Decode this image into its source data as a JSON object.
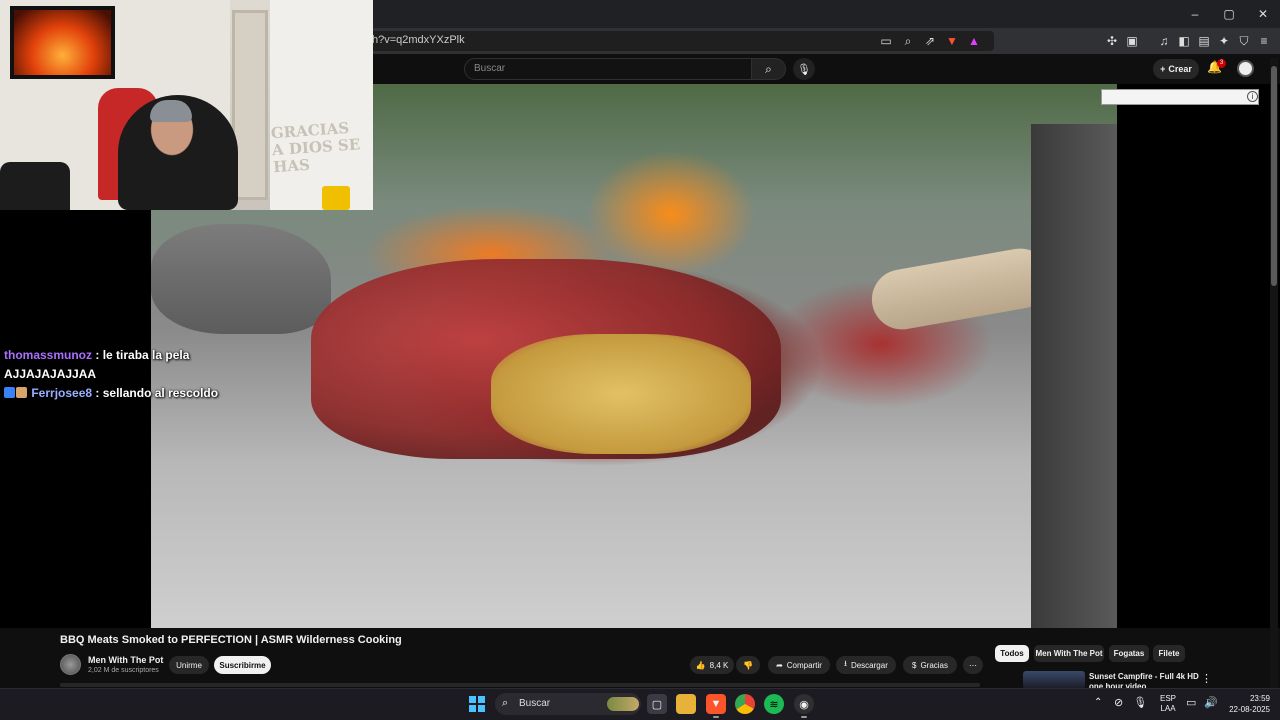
{
  "browser": {
    "url": "h?v=q2mdxYXzPlk",
    "window_controls": [
      "–",
      "▢",
      "✕"
    ],
    "url_icons": [
      "cast-icon",
      "zoom-icon",
      "share-icon",
      "brave-shield-icon",
      "rewards-icon"
    ],
    "extension_icons": [
      "puzzle-icon",
      "save-icon",
      "music-icon",
      "sidebar-icon",
      "wallet-icon",
      "leo-icon",
      "vpn-icon",
      "menu-icon"
    ]
  },
  "youtube_header": {
    "search_placeholder": "Buscar",
    "create_label": "Crear",
    "notification_count": "3"
  },
  "webcam": {
    "wall_text": "GRACIAS A DIOS SE HAS"
  },
  "chat": [
    {
      "user": "thomassmunoz",
      "message": "le tiraba la pela AJJAJAJAJJAA"
    },
    {
      "user": "Ferrjosee8",
      "message": "sellando al rescoldo"
    }
  ],
  "video": {
    "title": "BBQ Meats Smoked to PERFECTION | ASMR Wilderness Cooking",
    "channel": "Men With The Pot",
    "subscribers": "2,02 M de suscriptores",
    "join_label": "Unirme",
    "subscribe_label": "Suscribirme",
    "likes": "8,4 K",
    "share_label": "Compartir",
    "download_label": "Descargar",
    "thanks_label": "Gracias",
    "more_label": "⋯"
  },
  "chips": [
    "Todos",
    "Men With The Pot",
    "Fogatas",
    "Filete"
  ],
  "recommendation": {
    "title": "Sunset Campfire - Full 4k HD one hour video"
  },
  "taskbar": {
    "search_label": "Buscar",
    "lang_line1": "ESP",
    "lang_line2": "LAA",
    "time": "23:59",
    "date": "22-08-2025"
  },
  "colors": {
    "accent_red": "#cc0000",
    "chat_user1": "#a970ff",
    "chat_user2": "#9ab0ff"
  }
}
